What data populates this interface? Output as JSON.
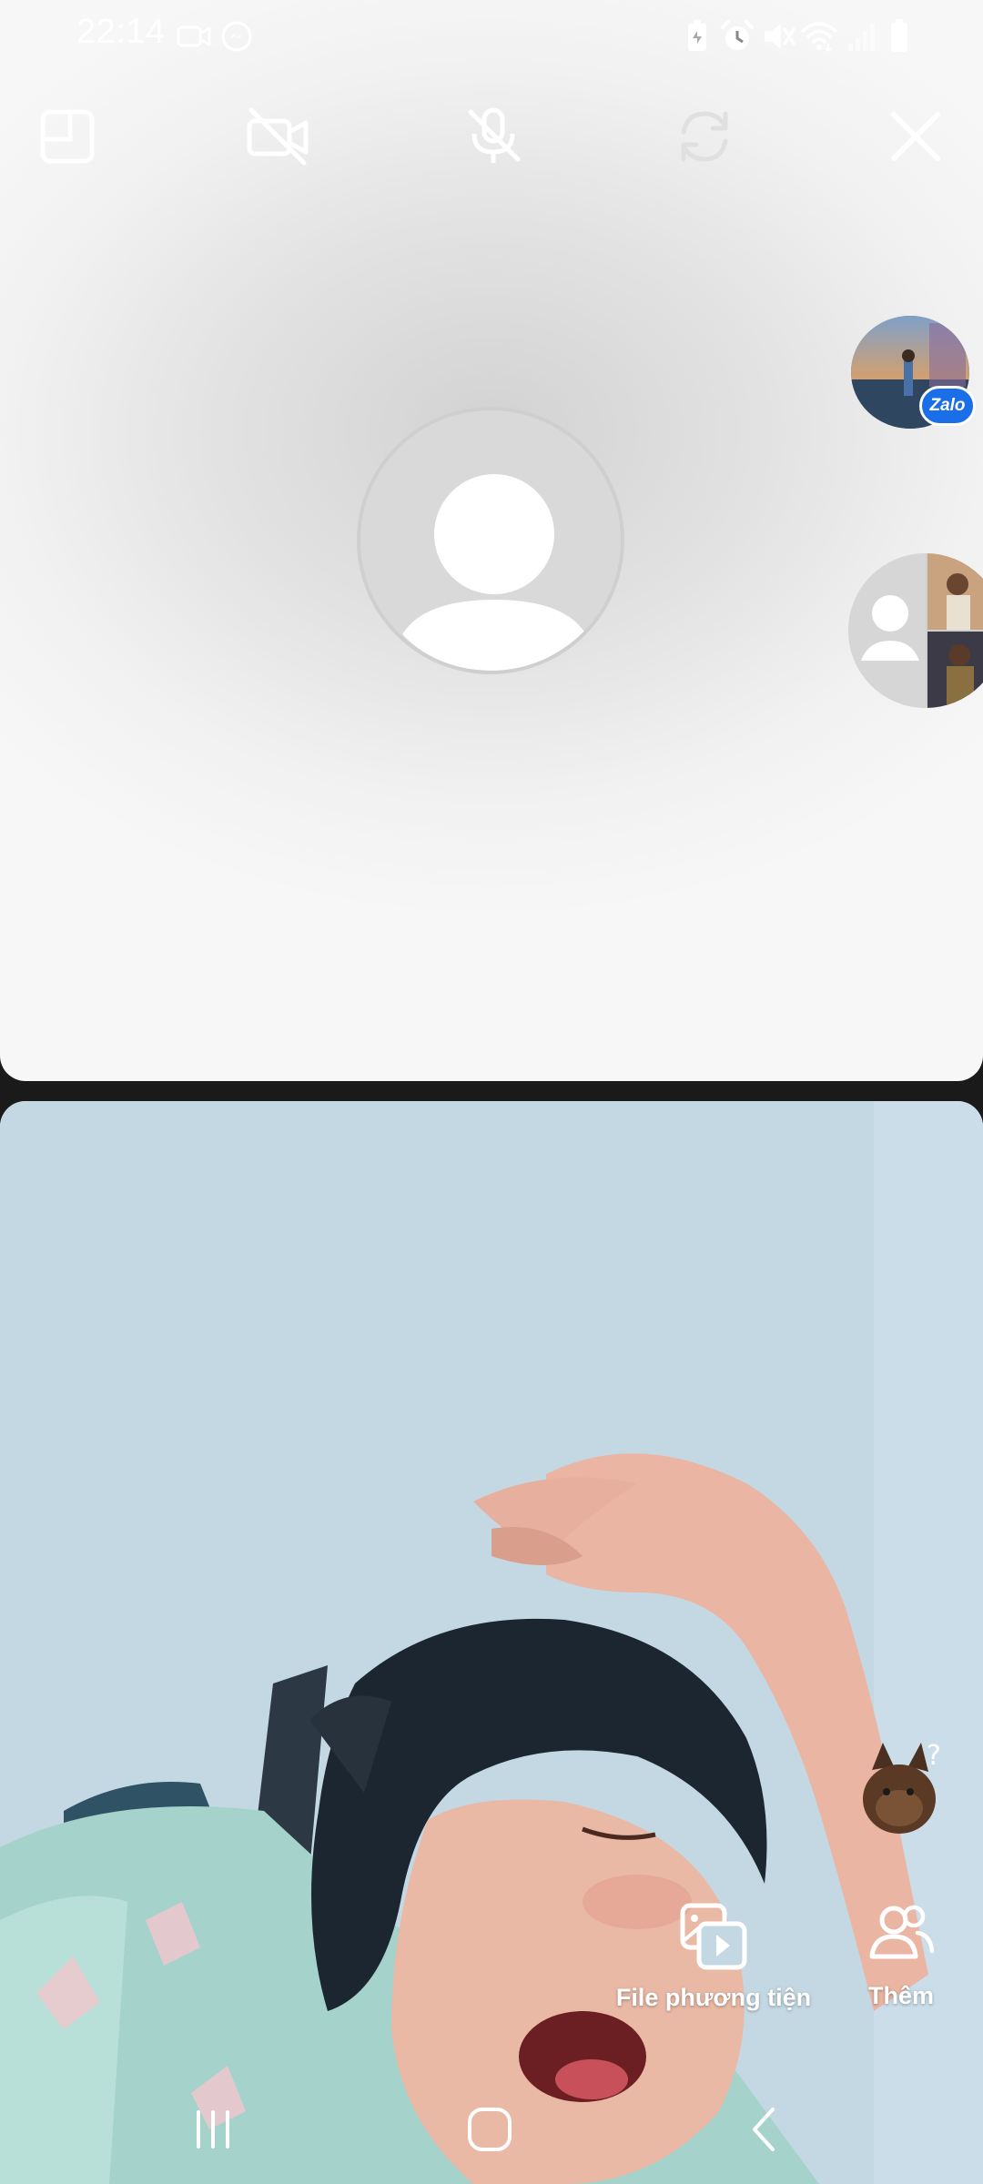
{
  "status_bar": {
    "time": "22:14",
    "left_icons": [
      "video-camera-icon",
      "messenger-icon"
    ],
    "right_icons": [
      "battery-saver-icon",
      "alarm-icon",
      "mute-icon",
      "wifi-icon",
      "signal-icon",
      "battery-icon"
    ]
  },
  "call_controls": {
    "items": [
      "minimize-window-icon",
      "camera-off-icon",
      "mic-off-icon",
      "switch-camera-icon",
      "close-icon"
    ]
  },
  "remote": {
    "avatar_icon": "default-user-avatar-icon"
  },
  "chat_heads": {
    "first_badge": "Zalo",
    "first_icon": "zalo-chat-head-icon",
    "second_icon": "group-chat-head-icon"
  },
  "sticker": {
    "icon": "confused-cat-sticker-icon",
    "mark": "?"
  },
  "actions": {
    "media_label": "File phương tiện",
    "more_label": "Thêm"
  },
  "nav": {
    "items": [
      "recents-icon",
      "home-icon",
      "back-icon"
    ]
  },
  "colors": {
    "accent_zalo": "#1a6ee8",
    "ui_white": "#ffffff"
  }
}
